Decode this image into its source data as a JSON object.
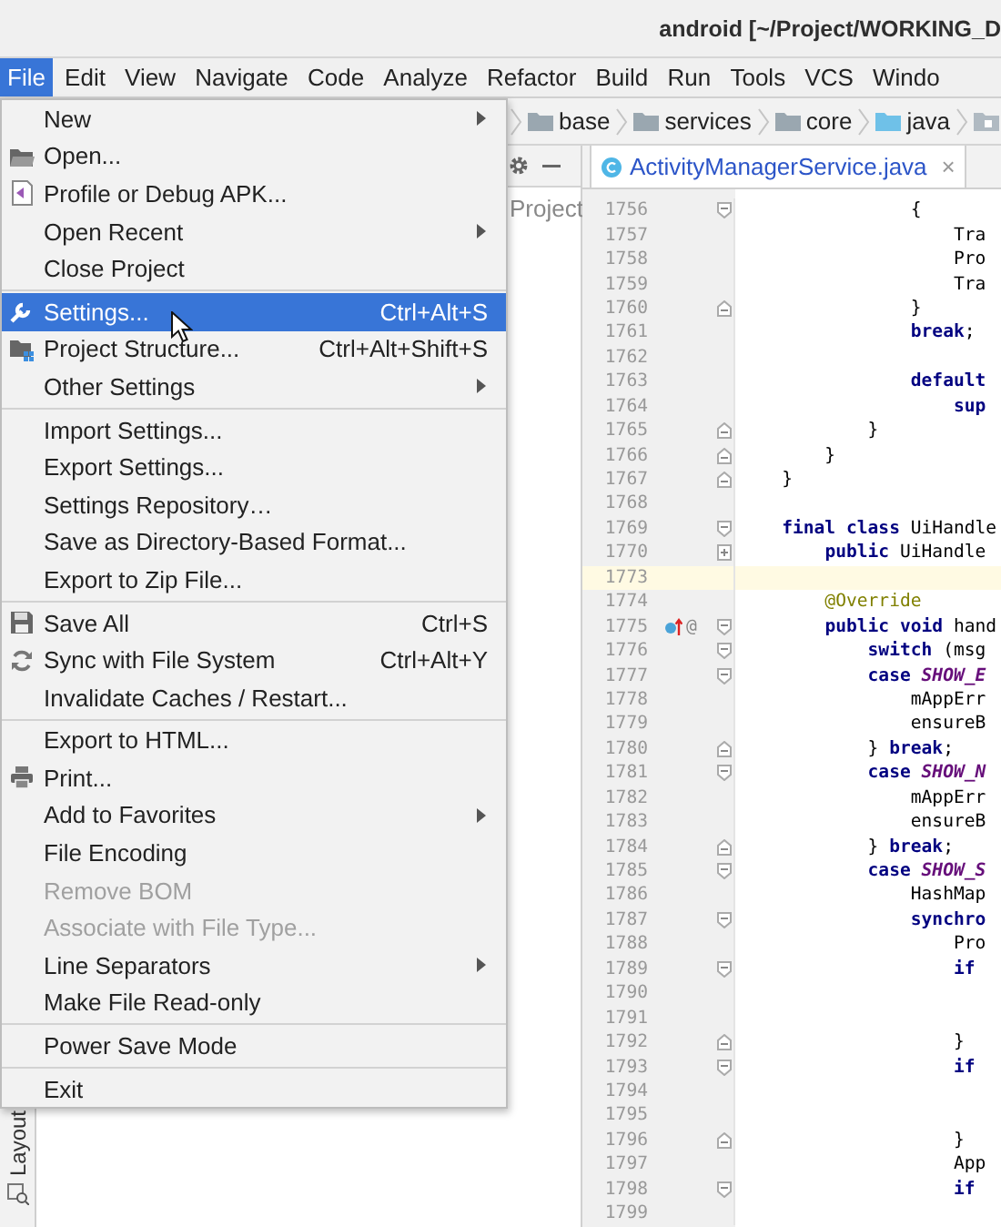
{
  "window": {
    "title": "android [~/Project/WORKING_D"
  },
  "menubar": [
    {
      "label": "File",
      "selected": true
    },
    {
      "label": "Edit",
      "selected": false
    },
    {
      "label": "View",
      "selected": false
    },
    {
      "label": "Navigate",
      "selected": false
    },
    {
      "label": "Code",
      "selected": false
    },
    {
      "label": "Analyze",
      "selected": false
    },
    {
      "label": "Refactor",
      "selected": false
    },
    {
      "label": "Build",
      "selected": false
    },
    {
      "label": "Run",
      "selected": false
    },
    {
      "label": "Tools",
      "selected": false
    },
    {
      "label": "VCS",
      "selected": false
    },
    {
      "label": "Windo",
      "selected": false
    }
  ],
  "breadcrumbs": [
    {
      "label": "base",
      "color": "#9aa7b0"
    },
    {
      "label": "services",
      "color": "#9aa7b0"
    },
    {
      "label": "core",
      "color": "#9aa7b0"
    },
    {
      "label": "java",
      "color": "#6fc1e8"
    }
  ],
  "project_panel": {
    "title": "Project"
  },
  "editor": {
    "tab": {
      "label": "ActivityManagerService.java",
      "selected": true,
      "close": "×"
    },
    "lines": [
      {
        "number": "1756",
        "code": "                {",
        "kind": "code",
        "fold_start": true,
        "current": false,
        "markers": false
      },
      {
        "number": "1757",
        "code": "                    Tra",
        "kind": "code",
        "current": false,
        "markers": false
      },
      {
        "number": "1758",
        "code": "                    Pro",
        "kind": "code",
        "current": false,
        "markers": false
      },
      {
        "number": "1759",
        "code": "                    Tra",
        "kind": "code",
        "current": false,
        "markers": false
      },
      {
        "number": "1760",
        "code": "                }",
        "kind": "code",
        "fold_end": true,
        "current": false,
        "markers": false
      },
      {
        "number": "1761",
        "code": "                **break**;",
        "kind": "code",
        "current": false,
        "markers": false
      },
      {
        "number": "1762",
        "current": false,
        "markers": false
      },
      {
        "number": "1763",
        "code": "                **default**",
        "kind": "code",
        "current": false,
        "markers": false
      },
      {
        "number": "1764",
        "code": "                    **sup**",
        "kind": "code",
        "current": false,
        "markers": false
      },
      {
        "number": "1765",
        "code": "            }",
        "kind": "code",
        "fold_end": true,
        "current": false,
        "markers": false
      },
      {
        "number": "1766",
        "code": "        }",
        "kind": "code",
        "fold_end": true,
        "current": false,
        "markers": false
      },
      {
        "number": "1767",
        "code": "    }",
        "kind": "code",
        "fold_end": true,
        "current": false,
        "markers": false
      },
      {
        "number": "1768",
        "current": false,
        "markers": false
      },
      {
        "number": "1769",
        "code": "    **final class** UiHandle",
        "kind": "code",
        "fold_start": true,
        "current": false,
        "markers": false
      },
      {
        "number": "1770",
        "code": "        **public** UiHandle",
        "kind": "code",
        "folded": true,
        "current": false,
        "markers": false
      },
      {
        "number": "1773",
        "current": true,
        "markers": false
      },
      {
        "number": "1774",
        "code": "        @Override",
        "kind": "annotation",
        "current": false,
        "markers": false
      },
      {
        "number": "1775",
        "code": "        **public void** hand",
        "kind": "code",
        "fold_start": true,
        "current": false,
        "markers": true,
        "mark": "@"
      },
      {
        "number": "1776",
        "code": "            **switch** (msg",
        "kind": "code",
        "fold_start": true,
        "current": false,
        "markers": false
      },
      {
        "number": "1777",
        "code": "            **case** *SHOW_E*",
        "kind": "code",
        "fold_start": true,
        "current": false,
        "markers": false
      },
      {
        "number": "1778",
        "code": "                mAppErr",
        "kind": "code",
        "current": false,
        "markers": false
      },
      {
        "number": "1779",
        "code": "                ensureB",
        "kind": "code",
        "current": false,
        "markers": false
      },
      {
        "number": "1780",
        "code": "            } **break**;",
        "kind": "code",
        "fold_end": true,
        "current": false,
        "markers": false
      },
      {
        "number": "1781",
        "code": "            **case** *SHOW_N*",
        "kind": "code",
        "fold_start": true,
        "current": false,
        "markers": false
      },
      {
        "number": "1782",
        "code": "                mAppErr",
        "kind": "code",
        "current": false,
        "markers": false
      },
      {
        "number": "1783",
        "code": "                ensureB",
        "kind": "code",
        "current": false,
        "markers": false
      },
      {
        "number": "1784",
        "code": "            } **break**;",
        "kind": "code",
        "fold_end": true,
        "current": false,
        "markers": false
      },
      {
        "number": "1785",
        "code": "            **case** *SHOW_S*",
        "kind": "code",
        "fold_start": true,
        "current": false,
        "markers": false
      },
      {
        "number": "1786",
        "code": "                HashMap",
        "kind": "code",
        "current": false,
        "markers": false
      },
      {
        "number": "1787",
        "code": "                **synchro**",
        "kind": "code",
        "fold_start": true,
        "current": false,
        "markers": false
      },
      {
        "number": "1788",
        "code": "                    Pro",
        "kind": "code",
        "current": false,
        "markers": false
      },
      {
        "number": "1789",
        "code": "                    **if**",
        "kind": "code",
        "fold_start": true,
        "current": false,
        "markers": false
      },
      {
        "number": "1790",
        "current": false,
        "markers": false
      },
      {
        "number": "1791",
        "current": false,
        "markers": false
      },
      {
        "number": "1792",
        "code": "                    }",
        "kind": "code",
        "fold_end": true,
        "current": false,
        "markers": false
      },
      {
        "number": "1793",
        "code": "                    **if**",
        "kind": "code",
        "fold_start": true,
        "current": false,
        "markers": false
      },
      {
        "number": "1794",
        "current": false,
        "markers": false
      },
      {
        "number": "1795",
        "current": false,
        "markers": false
      },
      {
        "number": "1796",
        "code": "                    }",
        "kind": "code",
        "fold_end": true,
        "current": false,
        "markers": false
      },
      {
        "number": "1797",
        "code": "                    App",
        "kind": "code",
        "current": false,
        "markers": false
      },
      {
        "number": "1798",
        "code": "                    **if**",
        "kind": "code",
        "fold_start": true,
        "current": false,
        "markers": false
      },
      {
        "number": "1799",
        "current": false,
        "markers": false
      }
    ]
  },
  "file_menu": {
    "items": [
      {
        "kind": "item",
        "label": "New",
        "submenu": true,
        "disabled": false,
        "selected": false
      },
      {
        "kind": "item",
        "label": "Open...",
        "submenu": false,
        "disabled": false,
        "selected": false
      },
      {
        "kind": "item",
        "label": "Profile or Debug APK...",
        "submenu": false,
        "disabled": false,
        "selected": false
      },
      {
        "kind": "item",
        "label": "Open Recent",
        "submenu": true,
        "disabled": false,
        "selected": false
      },
      {
        "kind": "item",
        "label": "Close Project",
        "submenu": false,
        "disabled": false,
        "selected": false
      },
      {
        "kind": "separator"
      },
      {
        "kind": "item",
        "label": "Settings...",
        "shortcut": "Ctrl+Alt+S",
        "submenu": false,
        "disabled": false,
        "selected": true
      },
      {
        "kind": "item",
        "label": "Project Structure...",
        "shortcut": "Ctrl+Alt+Shift+S",
        "submenu": false,
        "disabled": false,
        "selected": false
      },
      {
        "kind": "item",
        "label": "Other Settings",
        "submenu": true,
        "disabled": false,
        "selected": false
      },
      {
        "kind": "separator"
      },
      {
        "kind": "item",
        "label": "Import Settings...",
        "submenu": false,
        "disabled": false,
        "selected": false
      },
      {
        "kind": "item",
        "label": "Export Settings...",
        "submenu": false,
        "disabled": false,
        "selected": false
      },
      {
        "kind": "item",
        "label": "Settings Repository…",
        "submenu": false,
        "disabled": false,
        "selected": false
      },
      {
        "kind": "item",
        "label": "Save as Directory-Based Format...",
        "submenu": false,
        "disabled": false,
        "selected": false
      },
      {
        "kind": "item",
        "label": "Export to Zip File...",
        "submenu": false,
        "disabled": false,
        "selected": false
      },
      {
        "kind": "separator"
      },
      {
        "kind": "item",
        "label": "Save All",
        "shortcut": "Ctrl+S",
        "submenu": false,
        "disabled": false,
        "selected": false
      },
      {
        "kind": "item",
        "label": "Sync with File System",
        "shortcut": "Ctrl+Alt+Y",
        "submenu": false,
        "disabled": false,
        "selected": false
      },
      {
        "kind": "item",
        "label": "Invalidate Caches / Restart...",
        "submenu": false,
        "disabled": false,
        "selected": false
      },
      {
        "kind": "separator"
      },
      {
        "kind": "item",
        "label": "Export to HTML...",
        "submenu": false,
        "disabled": false,
        "selected": false
      },
      {
        "kind": "item",
        "label": "Print...",
        "submenu": false,
        "disabled": false,
        "selected": false
      },
      {
        "kind": "item",
        "label": "Add to Favorites",
        "submenu": true,
        "disabled": false,
        "selected": false
      },
      {
        "kind": "item",
        "label": "File Encoding",
        "submenu": false,
        "disabled": false,
        "selected": false
      },
      {
        "kind": "item",
        "label": "Remove BOM",
        "submenu": false,
        "disabled": true,
        "selected": false
      },
      {
        "kind": "item",
        "label": "Associate with File Type...",
        "submenu": false,
        "disabled": true,
        "selected": false
      },
      {
        "kind": "item",
        "label": "Line Separators",
        "submenu": true,
        "disabled": false,
        "selected": false
      },
      {
        "kind": "item",
        "label": "Make File Read-only",
        "submenu": false,
        "disabled": false,
        "selected": false
      },
      {
        "kind": "separator"
      },
      {
        "kind": "item",
        "label": "Power Save Mode",
        "submenu": false,
        "disabled": false,
        "selected": false
      },
      {
        "kind": "separator"
      },
      {
        "kind": "item",
        "label": "Exit",
        "submenu": false,
        "disabled": false,
        "selected": false
      }
    ]
  },
  "tool_strip": {
    "label": "Layout"
  }
}
